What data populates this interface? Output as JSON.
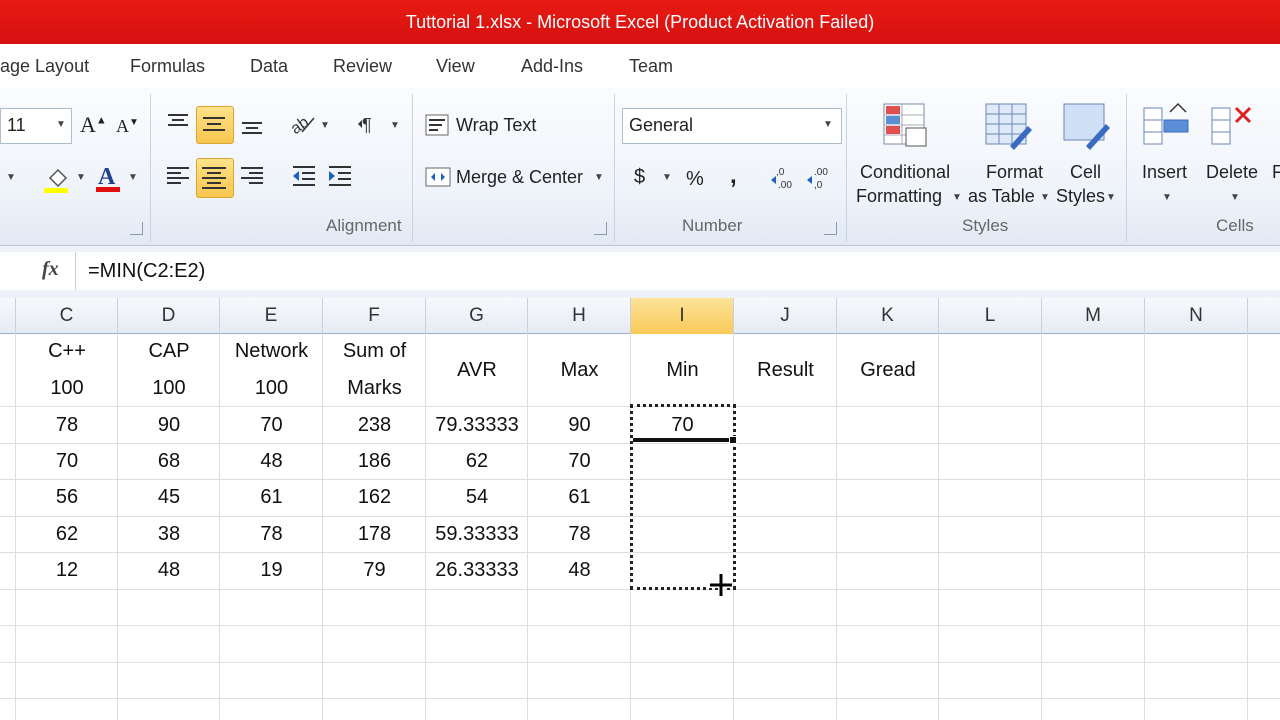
{
  "window": {
    "title": "Tuttorial 1.xlsx  -  Microsoft Excel (Product Activation Failed)"
  },
  "tabs": [
    "age Layout",
    "Formulas",
    "Data",
    "Review",
    "View",
    "Add-Ins",
    "Team"
  ],
  "ribbon": {
    "font_size": "11",
    "wrap_text": "Wrap Text",
    "merge_center": "Merge & Center",
    "number_format": "General",
    "currency": "$",
    "percent": "%",
    "comma": ",",
    "conditional_formatting": [
      "Conditional",
      "Formatting"
    ],
    "format_as_table": [
      "Format",
      "as Table"
    ],
    "cell_styles": [
      "Cell",
      "Styles"
    ],
    "insert": "Insert",
    "delete": "Delete",
    "format_partial": "F",
    "groups": {
      "alignment": "Alignment",
      "number": "Number",
      "styles": "Styles",
      "cells": "Cells"
    },
    "accent": "#f9c957"
  },
  "formula_bar": {
    "fx": "fx",
    "formula": "=MIN(C2:E2)"
  },
  "columns": [
    "C",
    "D",
    "E",
    "F",
    "G",
    "H",
    "I",
    "J",
    "K",
    "L",
    "M",
    "N"
  ],
  "selected_column": "I",
  "headers": {
    "C": [
      "C++",
      "100"
    ],
    "D": [
      "CAP",
      "100"
    ],
    "E": [
      "Network",
      "100"
    ],
    "F": [
      "Sum of",
      "Marks"
    ],
    "G": "AVR",
    "H": "Max",
    "I": "Min",
    "J": "Result",
    "K": "Gread"
  },
  "rows": [
    [
      "78",
      "90",
      "70",
      "238",
      "79.33333",
      "90",
      "70"
    ],
    [
      "70",
      "68",
      "48",
      "186",
      "62",
      "70",
      ""
    ],
    [
      "56",
      "45",
      "61",
      "162",
      "54",
      "61",
      ""
    ],
    [
      "62",
      "38",
      "78",
      "178",
      "59.33333",
      "78",
      ""
    ],
    [
      "12",
      "48",
      "19",
      "79",
      "26.33333",
      "48",
      ""
    ]
  ]
}
